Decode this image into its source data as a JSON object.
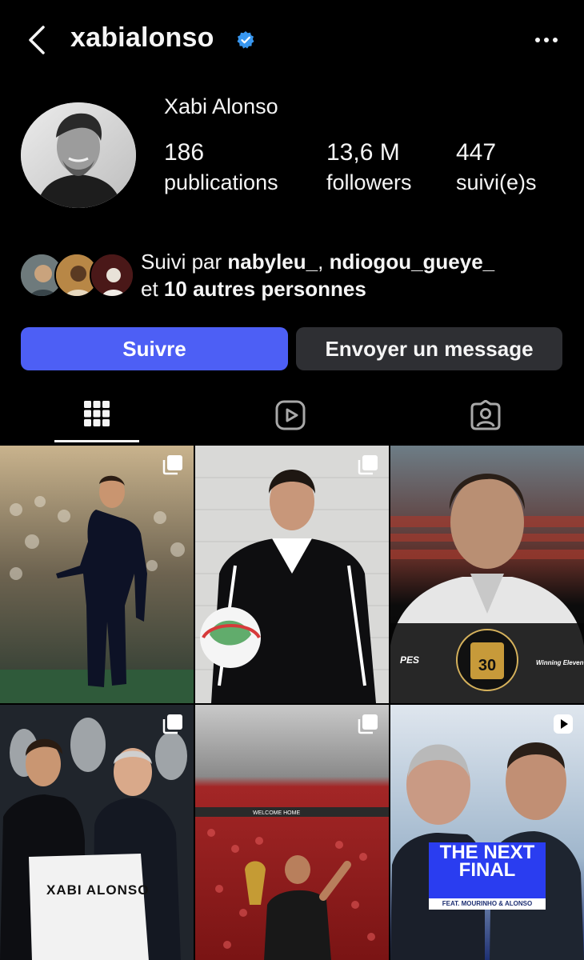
{
  "header": {
    "username": "xabialonso",
    "back_icon": "chevron-left-icon",
    "verified_icon": "verified-badge-icon",
    "more_icon": "more-horizontal-icon"
  },
  "profile": {
    "full_name": "Xabi Alonso",
    "stats": [
      {
        "value": "186",
        "label": "publications"
      },
      {
        "value": "13,6 M",
        "label": "followers"
      },
      {
        "value": "447",
        "label": "suivi(e)s"
      }
    ]
  },
  "followed_by": {
    "prefix": "Suivi par ",
    "user1": "nabyleu_",
    "separator": ", ",
    "user2": "ndiogou_gueye_",
    "line2_prefix": "et ",
    "others": "10 autres personnes"
  },
  "actions": {
    "follow_label": "Suivre",
    "message_label": "Envoyer un message"
  },
  "tabs": [
    {
      "icon": "grid-icon",
      "active": true
    },
    {
      "icon": "reels-icon",
      "active": false
    },
    {
      "icon": "tagged-icon",
      "active": false
    }
  ],
  "posts": [
    {
      "badge": "carousel-icon",
      "text": ""
    },
    {
      "badge": "carousel-icon",
      "text": ""
    },
    {
      "badge": "",
      "text": ""
    },
    {
      "badge": "carousel-icon",
      "text": "XABI ALONSO"
    },
    {
      "badge": "carousel-icon",
      "text": "WELCOME HOME"
    },
    {
      "badge": "reels-icon",
      "text": "THE NEXT FINAL",
      "subtext": "FEAT. MOURINHO & ALONSO"
    }
  ],
  "colors": {
    "background": "#000000",
    "follow_button": "#4d5ff5",
    "secondary_button": "#2e2f33",
    "verified": "#3897f0"
  }
}
